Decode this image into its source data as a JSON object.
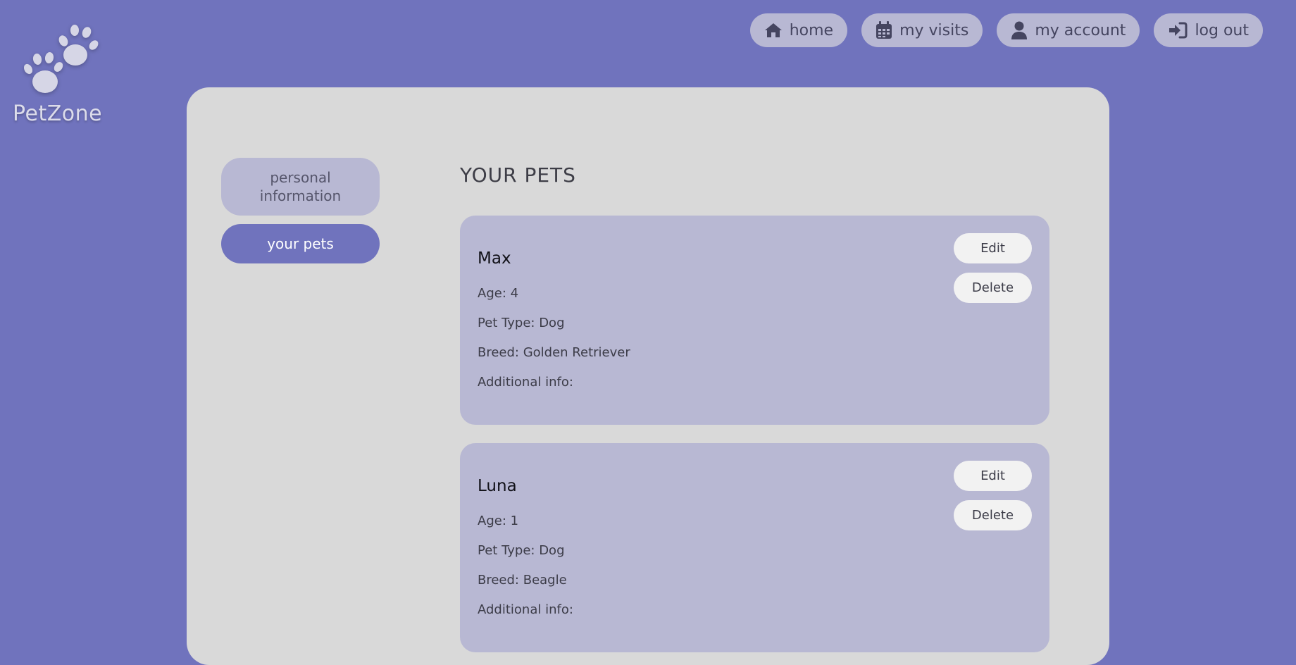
{
  "app": {
    "name": "PetZone",
    "logo_icon": "paw-print-icon",
    "colors": {
      "background": "#7073bd",
      "card": "#d9d9d9",
      "panel": "#b8b8d3",
      "button": "#f2f2f2"
    }
  },
  "nav": {
    "items": [
      {
        "label": "home",
        "icon": "home-icon"
      },
      {
        "label": "my visits",
        "icon": "calendar-icon"
      },
      {
        "label": "my account",
        "icon": "user-icon"
      },
      {
        "label": "log out",
        "icon": "sign-in-icon"
      }
    ]
  },
  "sidebar": {
    "items": [
      {
        "label": "personal information",
        "active": false
      },
      {
        "label": "your pets",
        "active": true
      }
    ]
  },
  "pets_section": {
    "title": "YOUR PETS",
    "edit_label": "Edit",
    "delete_label": "Delete",
    "pets": [
      {
        "name": "Max",
        "age": "Age: 4",
        "type": "Pet Type: Dog",
        "breed": "Breed: Golden Retriever",
        "info": "Additional info:"
      },
      {
        "name": "Luna",
        "age": "Age: 1",
        "type": "Pet Type: Dog",
        "breed": "Breed: Beagle",
        "info": "Additional info:"
      }
    ]
  }
}
